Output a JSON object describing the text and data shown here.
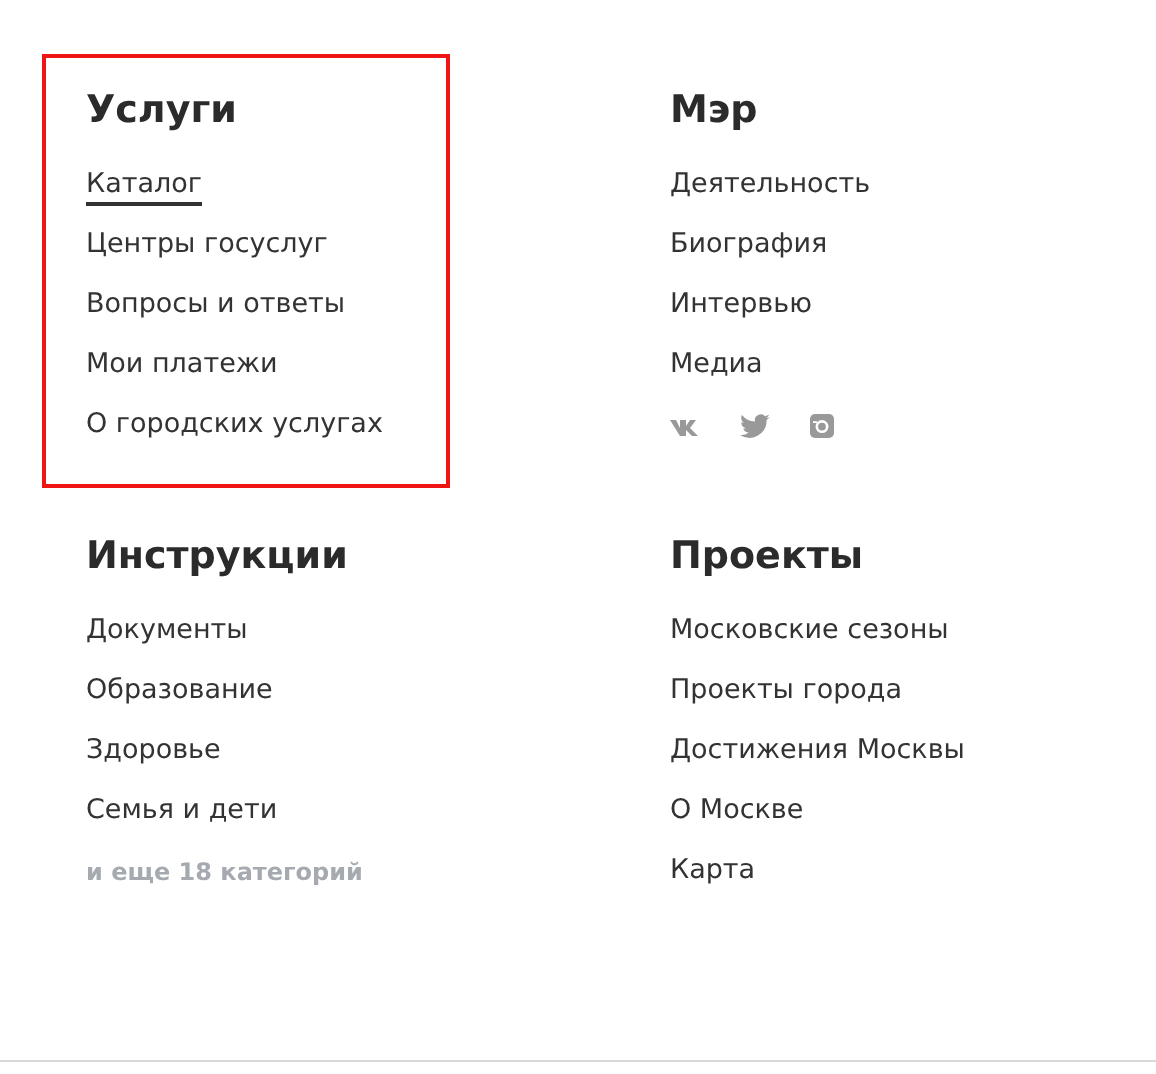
{
  "sections": [
    {
      "title": "Услуги",
      "highlighted": true,
      "items": [
        {
          "kind": "link",
          "label": "Каталог",
          "selected": true
        },
        {
          "kind": "link",
          "label": "Центры госуслуг",
          "selected": false
        },
        {
          "kind": "link",
          "label": "Вопросы и ответы",
          "selected": false
        },
        {
          "kind": "link",
          "label": "Мои платежи",
          "selected": false
        },
        {
          "kind": "link",
          "label": "О городских услугах",
          "selected": false
        }
      ]
    },
    {
      "title": "Мэр",
      "highlighted": false,
      "items": [
        {
          "kind": "link",
          "label": "Деятельность",
          "selected": false
        },
        {
          "kind": "link",
          "label": "Биография",
          "selected": false
        },
        {
          "kind": "link",
          "label": "Интервью",
          "selected": false
        },
        {
          "kind": "link",
          "label": "Медиа",
          "selected": false
        },
        {
          "kind": "social"
        }
      ]
    },
    {
      "title": "Инструкции",
      "highlighted": false,
      "items": [
        {
          "kind": "link",
          "label": "Документы",
          "selected": false
        },
        {
          "kind": "link",
          "label": "Образование",
          "selected": false
        },
        {
          "kind": "link",
          "label": "Здоровье",
          "selected": false
        },
        {
          "kind": "link",
          "label": "Семья и дети",
          "selected": false
        },
        {
          "kind": "more",
          "label": "и еще 18 категорий"
        }
      ]
    },
    {
      "title": "Проекты",
      "highlighted": false,
      "items": [
        {
          "kind": "link",
          "label": "Московские сезоны",
          "selected": false
        },
        {
          "kind": "link",
          "label": "Проекты города",
          "selected": false
        },
        {
          "kind": "link",
          "label": "Достижения Москвы",
          "selected": false
        },
        {
          "kind": "link",
          "label": "О Москве",
          "selected": false
        },
        {
          "kind": "link",
          "label": "Карта",
          "selected": false
        }
      ]
    }
  ]
}
